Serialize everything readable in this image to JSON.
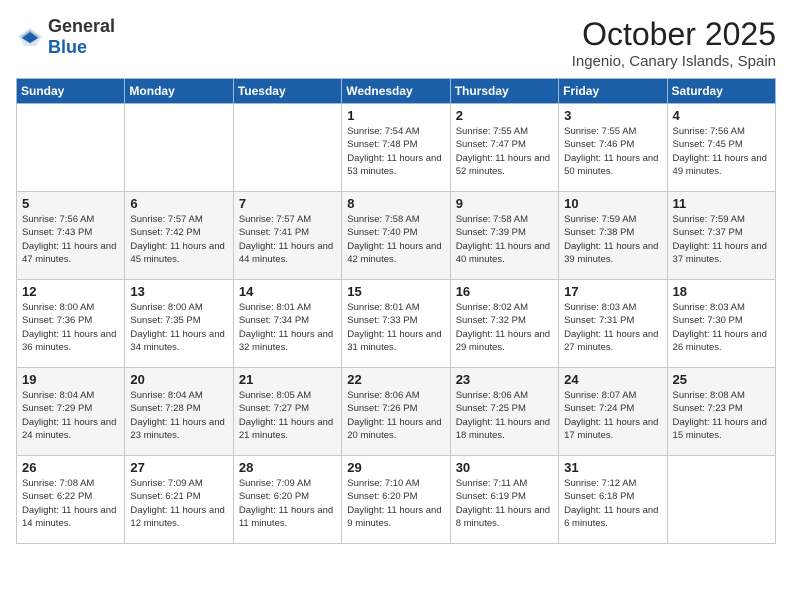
{
  "header": {
    "logo_general": "General",
    "logo_blue": "Blue",
    "month": "October 2025",
    "location": "Ingenio, Canary Islands, Spain"
  },
  "weekdays": [
    "Sunday",
    "Monday",
    "Tuesday",
    "Wednesday",
    "Thursday",
    "Friday",
    "Saturday"
  ],
  "weeks": [
    [
      {
        "day": "",
        "sunrise": "",
        "sunset": "",
        "daylight": ""
      },
      {
        "day": "",
        "sunrise": "",
        "sunset": "",
        "daylight": ""
      },
      {
        "day": "",
        "sunrise": "",
        "sunset": "",
        "daylight": ""
      },
      {
        "day": "1",
        "sunrise": "Sunrise: 7:54 AM",
        "sunset": "Sunset: 7:48 PM",
        "daylight": "Daylight: 11 hours and 53 minutes."
      },
      {
        "day": "2",
        "sunrise": "Sunrise: 7:55 AM",
        "sunset": "Sunset: 7:47 PM",
        "daylight": "Daylight: 11 hours and 52 minutes."
      },
      {
        "day": "3",
        "sunrise": "Sunrise: 7:55 AM",
        "sunset": "Sunset: 7:46 PM",
        "daylight": "Daylight: 11 hours and 50 minutes."
      },
      {
        "day": "4",
        "sunrise": "Sunrise: 7:56 AM",
        "sunset": "Sunset: 7:45 PM",
        "daylight": "Daylight: 11 hours and 49 minutes."
      }
    ],
    [
      {
        "day": "5",
        "sunrise": "Sunrise: 7:56 AM",
        "sunset": "Sunset: 7:43 PM",
        "daylight": "Daylight: 11 hours and 47 minutes."
      },
      {
        "day": "6",
        "sunrise": "Sunrise: 7:57 AM",
        "sunset": "Sunset: 7:42 PM",
        "daylight": "Daylight: 11 hours and 45 minutes."
      },
      {
        "day": "7",
        "sunrise": "Sunrise: 7:57 AM",
        "sunset": "Sunset: 7:41 PM",
        "daylight": "Daylight: 11 hours and 44 minutes."
      },
      {
        "day": "8",
        "sunrise": "Sunrise: 7:58 AM",
        "sunset": "Sunset: 7:40 PM",
        "daylight": "Daylight: 11 hours and 42 minutes."
      },
      {
        "day": "9",
        "sunrise": "Sunrise: 7:58 AM",
        "sunset": "Sunset: 7:39 PM",
        "daylight": "Daylight: 11 hours and 40 minutes."
      },
      {
        "day": "10",
        "sunrise": "Sunrise: 7:59 AM",
        "sunset": "Sunset: 7:38 PM",
        "daylight": "Daylight: 11 hours and 39 minutes."
      },
      {
        "day": "11",
        "sunrise": "Sunrise: 7:59 AM",
        "sunset": "Sunset: 7:37 PM",
        "daylight": "Daylight: 11 hours and 37 minutes."
      }
    ],
    [
      {
        "day": "12",
        "sunrise": "Sunrise: 8:00 AM",
        "sunset": "Sunset: 7:36 PM",
        "daylight": "Daylight: 11 hours and 36 minutes."
      },
      {
        "day": "13",
        "sunrise": "Sunrise: 8:00 AM",
        "sunset": "Sunset: 7:35 PM",
        "daylight": "Daylight: 11 hours and 34 minutes."
      },
      {
        "day": "14",
        "sunrise": "Sunrise: 8:01 AM",
        "sunset": "Sunset: 7:34 PM",
        "daylight": "Daylight: 11 hours and 32 minutes."
      },
      {
        "day": "15",
        "sunrise": "Sunrise: 8:01 AM",
        "sunset": "Sunset: 7:33 PM",
        "daylight": "Daylight: 11 hours and 31 minutes."
      },
      {
        "day": "16",
        "sunrise": "Sunrise: 8:02 AM",
        "sunset": "Sunset: 7:32 PM",
        "daylight": "Daylight: 11 hours and 29 minutes."
      },
      {
        "day": "17",
        "sunrise": "Sunrise: 8:03 AM",
        "sunset": "Sunset: 7:31 PM",
        "daylight": "Daylight: 11 hours and 27 minutes."
      },
      {
        "day": "18",
        "sunrise": "Sunrise: 8:03 AM",
        "sunset": "Sunset: 7:30 PM",
        "daylight": "Daylight: 11 hours and 26 minutes."
      }
    ],
    [
      {
        "day": "19",
        "sunrise": "Sunrise: 8:04 AM",
        "sunset": "Sunset: 7:29 PM",
        "daylight": "Daylight: 11 hours and 24 minutes."
      },
      {
        "day": "20",
        "sunrise": "Sunrise: 8:04 AM",
        "sunset": "Sunset: 7:28 PM",
        "daylight": "Daylight: 11 hours and 23 minutes."
      },
      {
        "day": "21",
        "sunrise": "Sunrise: 8:05 AM",
        "sunset": "Sunset: 7:27 PM",
        "daylight": "Daylight: 11 hours and 21 minutes."
      },
      {
        "day": "22",
        "sunrise": "Sunrise: 8:06 AM",
        "sunset": "Sunset: 7:26 PM",
        "daylight": "Daylight: 11 hours and 20 minutes."
      },
      {
        "day": "23",
        "sunrise": "Sunrise: 8:06 AM",
        "sunset": "Sunset: 7:25 PM",
        "daylight": "Daylight: 11 hours and 18 minutes."
      },
      {
        "day": "24",
        "sunrise": "Sunrise: 8:07 AM",
        "sunset": "Sunset: 7:24 PM",
        "daylight": "Daylight: 11 hours and 17 minutes."
      },
      {
        "day": "25",
        "sunrise": "Sunrise: 8:08 AM",
        "sunset": "Sunset: 7:23 PM",
        "daylight": "Daylight: 11 hours and 15 minutes."
      }
    ],
    [
      {
        "day": "26",
        "sunrise": "Sunrise: 7:08 AM",
        "sunset": "Sunset: 6:22 PM",
        "daylight": "Daylight: 11 hours and 14 minutes."
      },
      {
        "day": "27",
        "sunrise": "Sunrise: 7:09 AM",
        "sunset": "Sunset: 6:21 PM",
        "daylight": "Daylight: 11 hours and 12 minutes."
      },
      {
        "day": "28",
        "sunrise": "Sunrise: 7:09 AM",
        "sunset": "Sunset: 6:20 PM",
        "daylight": "Daylight: 11 hours and 11 minutes."
      },
      {
        "day": "29",
        "sunrise": "Sunrise: 7:10 AM",
        "sunset": "Sunset: 6:20 PM",
        "daylight": "Daylight: 11 hours and 9 minutes."
      },
      {
        "day": "30",
        "sunrise": "Sunrise: 7:11 AM",
        "sunset": "Sunset: 6:19 PM",
        "daylight": "Daylight: 11 hours and 8 minutes."
      },
      {
        "day": "31",
        "sunrise": "Sunrise: 7:12 AM",
        "sunset": "Sunset: 6:18 PM",
        "daylight": "Daylight: 11 hours and 6 minutes."
      },
      {
        "day": "",
        "sunrise": "",
        "sunset": "",
        "daylight": ""
      }
    ]
  ]
}
